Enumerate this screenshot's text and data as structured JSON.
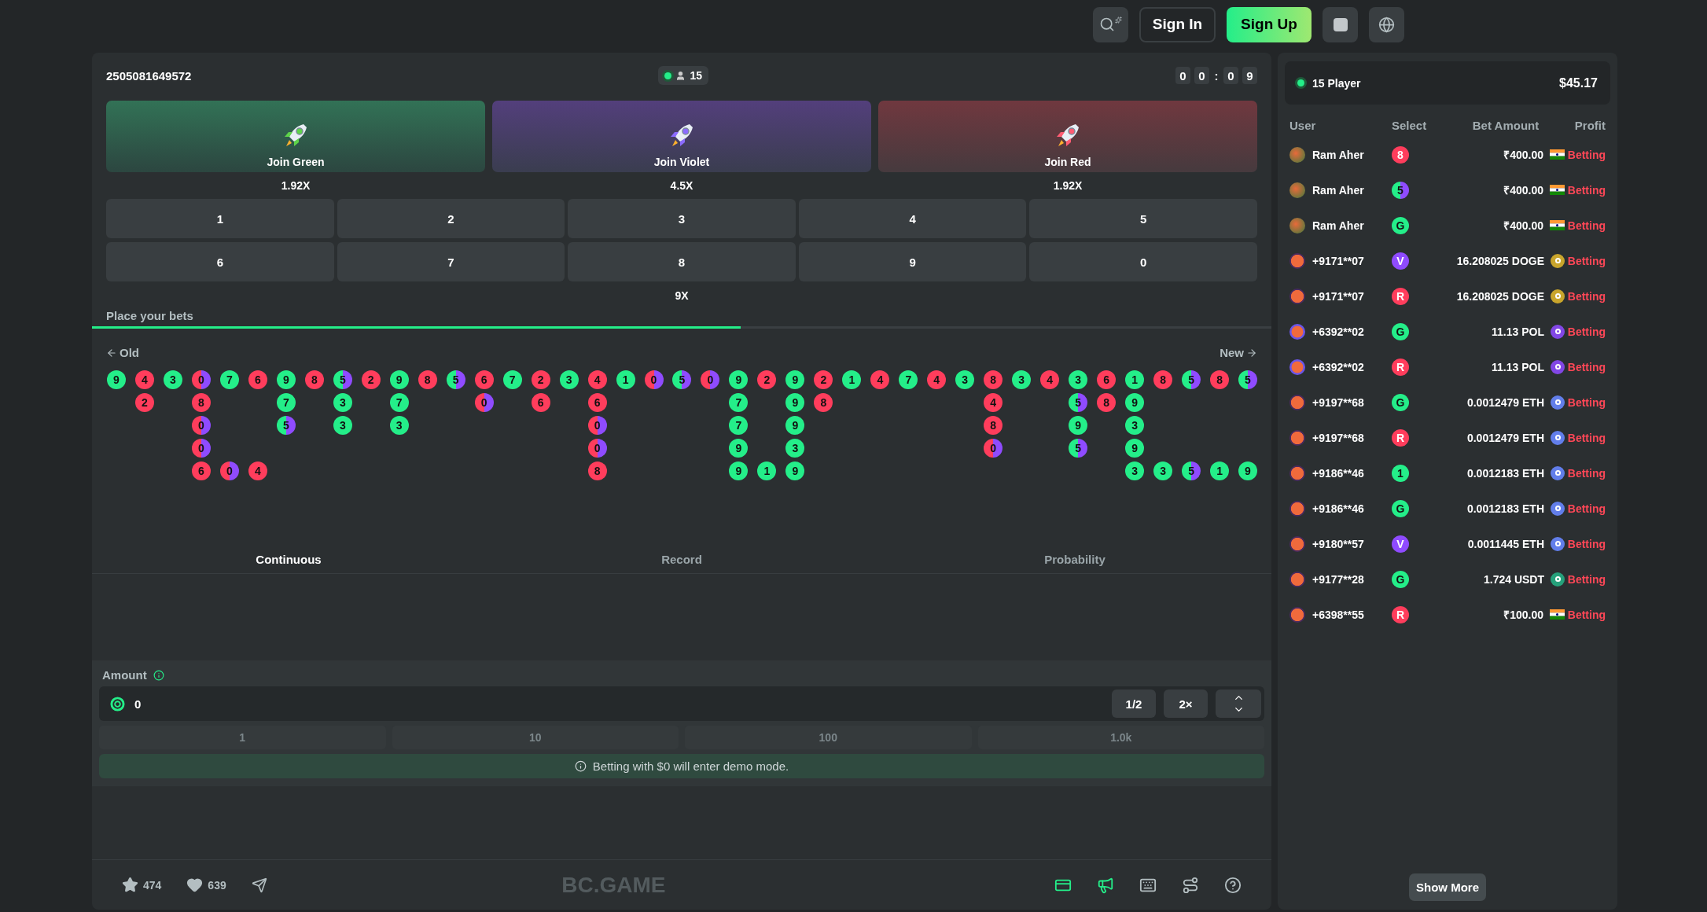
{
  "topbar": {
    "buttons": [
      {
        "kind": "search"
      },
      {
        "kind": "signin",
        "label": "Sign In"
      },
      {
        "kind": "signup",
        "label": "Sign Up"
      },
      {
        "kind": "chat"
      },
      {
        "kind": "globe"
      }
    ]
  },
  "game": {
    "round_id": "2505081649572",
    "online": "15",
    "timer": [
      "0",
      "0",
      ":",
      "0",
      "9"
    ],
    "joins": [
      {
        "kind": "green",
        "label": "Join Green",
        "payout": "1.92X"
      },
      {
        "kind": "violet",
        "label": "Join Violet",
        "payout": "4.5X"
      },
      {
        "kind": "red",
        "label": "Join Red",
        "payout": "1.92X"
      }
    ],
    "numbers": [
      "1",
      "2",
      "3",
      "4",
      "5",
      "6",
      "7",
      "8",
      "9",
      "0"
    ],
    "number_payout": "9X",
    "status": "Place your bets",
    "progress": {
      "level": 0.55
    },
    "history": {
      "old": "Old",
      "new": "New",
      "columns": [
        [
          {
            "n": "9",
            "kind": "g"
          }
        ],
        [
          {
            "n": "4",
            "kind": "r"
          },
          {
            "n": "2",
            "kind": "r"
          }
        ],
        [
          {
            "n": "3",
            "kind": "g"
          }
        ],
        [
          {
            "n": "0",
            "kind": "rv"
          },
          {
            "n": "8",
            "kind": "r"
          },
          {
            "n": "0",
            "kind": "rv"
          },
          {
            "n": "0",
            "kind": "rv"
          },
          {
            "n": "6",
            "kind": "r"
          }
        ],
        [
          {
            "n": "7",
            "kind": "g"
          },
          null,
          null,
          null,
          {
            "n": "0",
            "kind": "rv"
          }
        ],
        [
          {
            "n": "6",
            "kind": "r"
          },
          null,
          null,
          null,
          {
            "n": "4",
            "kind": "r"
          }
        ],
        [
          {
            "n": "9",
            "kind": "g"
          },
          {
            "n": "7",
            "kind": "g"
          },
          {
            "n": "5",
            "kind": "gv"
          }
        ],
        [
          {
            "n": "8",
            "kind": "r"
          }
        ],
        [
          {
            "n": "5",
            "kind": "gv"
          },
          {
            "n": "3",
            "kind": "g"
          },
          {
            "n": "3",
            "kind": "g"
          }
        ],
        [
          {
            "n": "2",
            "kind": "r"
          }
        ],
        [
          {
            "n": "9",
            "kind": "g"
          },
          {
            "n": "7",
            "kind": "g"
          },
          {
            "n": "3",
            "kind": "g"
          }
        ],
        [
          {
            "n": "8",
            "kind": "r"
          }
        ],
        [
          {
            "n": "5",
            "kind": "gv"
          }
        ],
        [
          {
            "n": "6",
            "kind": "r"
          },
          {
            "n": "0",
            "kind": "rv"
          }
        ],
        [
          {
            "n": "7",
            "kind": "g"
          }
        ],
        [
          {
            "n": "2",
            "kind": "r"
          },
          {
            "n": "6",
            "kind": "r"
          }
        ],
        [
          {
            "n": "3",
            "kind": "g"
          }
        ],
        [
          {
            "n": "4",
            "kind": "r"
          },
          {
            "n": "6",
            "kind": "r"
          },
          {
            "n": "0",
            "kind": "rv"
          },
          {
            "n": "0",
            "kind": "rv"
          },
          {
            "n": "8",
            "kind": "r"
          }
        ],
        [
          {
            "n": "1",
            "kind": "g"
          }
        ],
        [
          {
            "n": "0",
            "kind": "rv"
          }
        ],
        [
          {
            "n": "5",
            "kind": "gv"
          }
        ],
        [
          {
            "n": "0",
            "kind": "rv"
          }
        ],
        [
          {
            "n": "9",
            "kind": "g"
          },
          {
            "n": "7",
            "kind": "g"
          },
          {
            "n": "7",
            "kind": "g"
          },
          {
            "n": "9",
            "kind": "g"
          },
          {
            "n": "9",
            "kind": "g"
          }
        ],
        [
          {
            "n": "2",
            "kind": "r"
          },
          null,
          null,
          null,
          {
            "n": "1",
            "kind": "g"
          }
        ],
        [
          {
            "n": "9",
            "kind": "g"
          },
          {
            "n": "9",
            "kind": "g"
          },
          {
            "n": "9",
            "kind": "g"
          },
          {
            "n": "3",
            "kind": "g"
          },
          {
            "n": "9",
            "kind": "g"
          }
        ],
        [
          {
            "n": "2",
            "kind": "r"
          },
          {
            "n": "8",
            "kind": "r"
          }
        ],
        [
          {
            "n": "1",
            "kind": "g"
          }
        ],
        [
          {
            "n": "4",
            "kind": "r"
          }
        ],
        [
          {
            "n": "7",
            "kind": "g"
          }
        ],
        [
          {
            "n": "4",
            "kind": "r"
          }
        ],
        [
          {
            "n": "3",
            "kind": "g"
          }
        ],
        [
          {
            "n": "8",
            "kind": "r"
          },
          {
            "n": "4",
            "kind": "r"
          },
          {
            "n": "8",
            "kind": "r"
          },
          {
            "n": "0",
            "kind": "rv"
          }
        ],
        [
          {
            "n": "3",
            "kind": "g"
          }
        ],
        [
          {
            "n": "4",
            "kind": "r"
          }
        ],
        [
          {
            "n": "3",
            "kind": "g"
          },
          {
            "n": "5",
            "kind": "gv"
          },
          {
            "n": "9",
            "kind": "g"
          },
          {
            "n": "5",
            "kind": "gv"
          }
        ],
        [
          {
            "n": "6",
            "kind": "r"
          },
          {
            "n": "8",
            "kind": "r"
          }
        ],
        [
          {
            "n": "1",
            "kind": "g"
          },
          {
            "n": "9",
            "kind": "g"
          },
          {
            "n": "3",
            "kind": "g"
          },
          {
            "n": "9",
            "kind": "g"
          },
          {
            "n": "3",
            "kind": "g"
          }
        ],
        [
          {
            "n": "8",
            "kind": "r"
          },
          null,
          null,
          null,
          {
            "n": "3",
            "kind": "g"
          }
        ],
        [
          {
            "n": "5",
            "kind": "gv"
          },
          null,
          null,
          null,
          {
            "n": "5",
            "kind": "gv"
          }
        ],
        [
          {
            "n": "8",
            "kind": "r"
          },
          null,
          null,
          null,
          {
            "n": "1",
            "kind": "g"
          }
        ],
        [
          {
            "n": "5",
            "kind": "gv"
          },
          null,
          null,
          null,
          {
            "n": "9",
            "kind": "g"
          }
        ]
      ]
    },
    "tabs": [
      {
        "label": "Continuous",
        "selected": true
      },
      {
        "label": "Record",
        "selected": false
      },
      {
        "label": "Probability",
        "selected": false
      }
    ],
    "amount": {
      "label": "Amount",
      "value": "0",
      "half": "1/2",
      "double": "2×",
      "quick": [
        "1",
        "10",
        "100",
        "1.0k"
      ],
      "notice": "Betting with $0 will enter demo mode."
    },
    "footer": {
      "stars": "474",
      "likes": "639",
      "logo": "BC.GAME",
      "tools": [
        {
          "kind": "card",
          "active": true
        },
        {
          "kind": "sound",
          "active": true
        },
        {
          "kind": "keyboard",
          "active": false
        },
        {
          "kind": "route",
          "active": false
        },
        {
          "kind": "help",
          "active": false
        }
      ]
    }
  },
  "players": {
    "count": "15 Player",
    "total": "$45.17",
    "columns": [
      "User",
      "Select",
      "Bet Amount",
      "Profit"
    ],
    "rows": [
      {
        "user": "Ram Aher",
        "avatar": {
          "kind": "a"
        },
        "select": {
          "label": "8",
          "kind": "r"
        },
        "amount": "₹400.00",
        "currency": {
          "kind": "inr"
        },
        "profit": "Betting"
      },
      {
        "user": "Ram Aher",
        "avatar": {
          "kind": "a"
        },
        "select": {
          "label": "5",
          "kind": "gv"
        },
        "amount": "₹400.00",
        "currency": {
          "kind": "inr"
        },
        "profit": "Betting"
      },
      {
        "user": "Ram Aher",
        "avatar": {
          "kind": "a"
        },
        "select": {
          "label": "G",
          "kind": "g"
        },
        "amount": "₹400.00",
        "currency": {
          "kind": "inr"
        },
        "profit": "Betting"
      },
      {
        "user": "+9171**07",
        "avatar": {
          "kind": "b"
        },
        "select": {
          "label": "V",
          "kind": "v"
        },
        "amount": "16.208025 DOGE",
        "currency": {
          "kind": "doge"
        },
        "profit": "Betting"
      },
      {
        "user": "+9171**07",
        "avatar": {
          "kind": "b"
        },
        "select": {
          "label": "R",
          "kind": "r"
        },
        "amount": "16.208025 DOGE",
        "currency": {
          "kind": "doge"
        },
        "profit": "Betting"
      },
      {
        "user": "+6392**02",
        "avatar": {
          "kind": "c"
        },
        "select": {
          "label": "G",
          "kind": "g"
        },
        "amount": "11.13 POL",
        "currency": {
          "kind": "pol"
        },
        "profit": "Betting"
      },
      {
        "user": "+6392**02",
        "avatar": {
          "kind": "c"
        },
        "select": {
          "label": "R",
          "kind": "r"
        },
        "amount": "11.13 POL",
        "currency": {
          "kind": "pol"
        },
        "profit": "Betting"
      },
      {
        "user": "+9197**68",
        "avatar": {
          "kind": "b"
        },
        "select": {
          "label": "G",
          "kind": "g"
        },
        "amount": "0.0012479 ETH",
        "currency": {
          "kind": "eth"
        },
        "profit": "Betting"
      },
      {
        "user": "+9197**68",
        "avatar": {
          "kind": "b"
        },
        "select": {
          "label": "R",
          "kind": "r"
        },
        "amount": "0.0012479 ETH",
        "currency": {
          "kind": "eth"
        },
        "profit": "Betting"
      },
      {
        "user": "+9186**46",
        "avatar": {
          "kind": "b"
        },
        "select": {
          "label": "1",
          "kind": "g"
        },
        "amount": "0.0012183 ETH",
        "currency": {
          "kind": "eth"
        },
        "profit": "Betting"
      },
      {
        "user": "+9186**46",
        "avatar": {
          "kind": "b"
        },
        "select": {
          "label": "G",
          "kind": "g"
        },
        "amount": "0.0012183 ETH",
        "currency": {
          "kind": "eth"
        },
        "profit": "Betting"
      },
      {
        "user": "+9180**57",
        "avatar": {
          "kind": "b"
        },
        "select": {
          "label": "V",
          "kind": "v"
        },
        "amount": "0.0011445 ETH",
        "currency": {
          "kind": "eth"
        },
        "profit": "Betting"
      },
      {
        "user": "+9177**28",
        "avatar": {
          "kind": "b"
        },
        "select": {
          "label": "G",
          "kind": "g"
        },
        "amount": "1.724 USDT",
        "currency": {
          "kind": "usdt"
        },
        "profit": "Betting"
      },
      {
        "user": "+6398**55",
        "avatar": {
          "kind": "b"
        },
        "select": {
          "label": "R",
          "kind": "r"
        },
        "amount": "₹100.00",
        "currency": {
          "kind": "inr"
        },
        "profit": "Betting"
      }
    ],
    "show_more": "Show More"
  }
}
